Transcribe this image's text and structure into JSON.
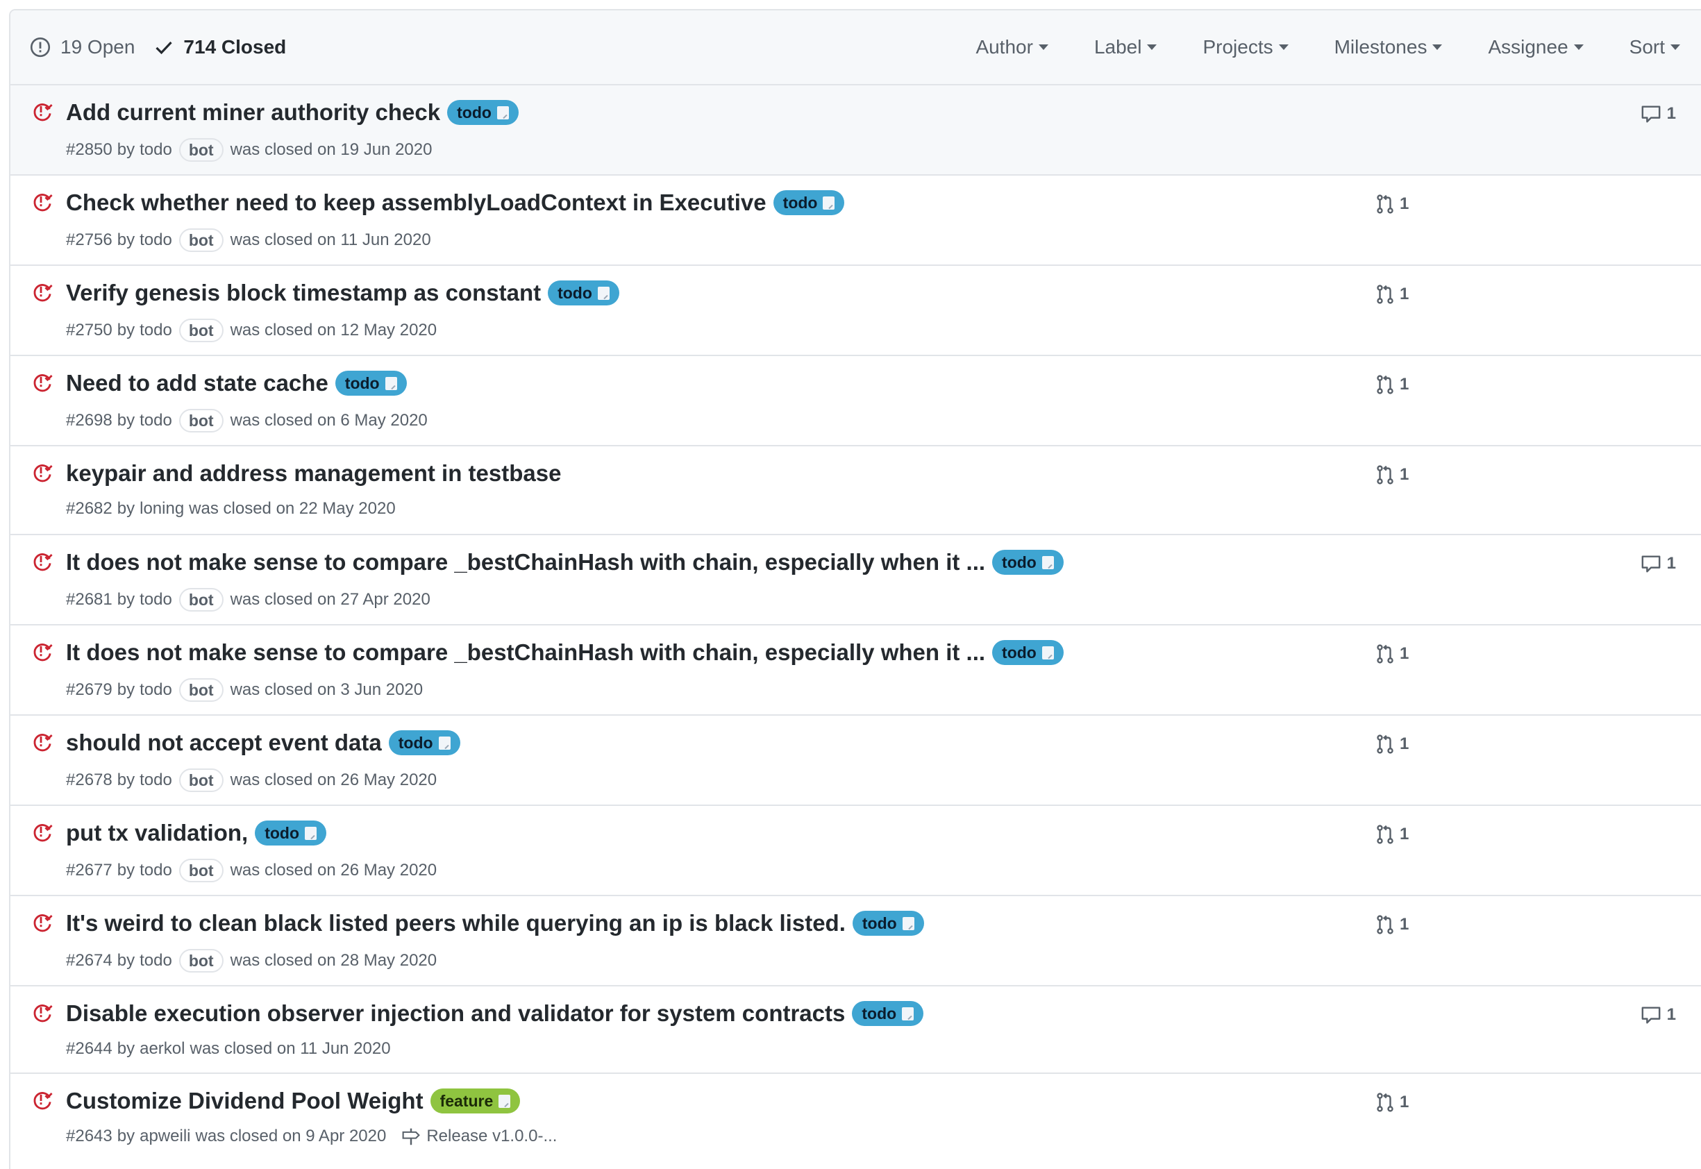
{
  "header": {
    "open_label": "19 Open",
    "closed_label": "714 Closed",
    "filters": [
      "Author",
      "Label",
      "Projects",
      "Milestones",
      "Assignee",
      "Sort"
    ]
  },
  "colors": {
    "closed_icon": "#cb2431",
    "label_todo": "#3fa5d2",
    "label_feature": "#8fc440"
  },
  "issues": [
    {
      "title": "Add current miner authority check",
      "label": "todo",
      "number": "#2850",
      "by": "by",
      "author": "todo",
      "bot": "bot",
      "closed": "was closed on 19 Jun 2020",
      "comments": "1",
      "prs": ""
    },
    {
      "title": "Check whether need to keep assemblyLoadContext in Executive",
      "label": "todo",
      "number": "#2756",
      "by": "by",
      "author": "todo",
      "bot": "bot",
      "closed": "was closed on 11 Jun 2020",
      "comments": "",
      "prs": "1"
    },
    {
      "title": "Verify genesis block timestamp as constant",
      "label": "todo",
      "number": "#2750",
      "by": "by",
      "author": "todo",
      "bot": "bot",
      "closed": "was closed on 12 May 2020",
      "comments": "",
      "prs": "1"
    },
    {
      "title": "Need to add state cache",
      "label": "todo",
      "number": "#2698",
      "by": "by",
      "author": "todo",
      "bot": "bot",
      "closed": "was closed on 6 May 2020",
      "comments": "",
      "prs": "1"
    },
    {
      "title": "keypair and address management in testbase",
      "label": "",
      "number": "#2682",
      "by": "by",
      "author": "loning",
      "bot": "",
      "closed": "was closed on 22 May 2020",
      "comments": "",
      "prs": "1"
    },
    {
      "title": "It does not make sense to compare _bestChainHash with chain, especially when it ...",
      "label": "todo",
      "number": "#2681",
      "by": "by",
      "author": "todo",
      "bot": "bot",
      "closed": "was closed on 27 Apr 2020",
      "comments": "1",
      "prs": ""
    },
    {
      "title": "It does not make sense to compare _bestChainHash with chain, especially when it ...",
      "label": "todo",
      "number": "#2679",
      "by": "by",
      "author": "todo",
      "bot": "bot",
      "closed": "was closed on 3 Jun 2020",
      "comments": "",
      "prs": "1"
    },
    {
      "title": "should not accept event data",
      "label": "todo",
      "number": "#2678",
      "by": "by",
      "author": "todo",
      "bot": "bot",
      "closed": "was closed on 26 May 2020",
      "comments": "",
      "prs": "1"
    },
    {
      "title": "put tx validation,",
      "label": "todo",
      "number": "#2677",
      "by": "by",
      "author": "todo",
      "bot": "bot",
      "closed": "was closed on 26 May 2020",
      "comments": "",
      "prs": "1"
    },
    {
      "title": "It's weird to clean black listed peers while querying an ip is black listed.",
      "label": "todo",
      "number": "#2674",
      "by": "by",
      "author": "todo",
      "bot": "bot",
      "closed": "was closed on 28 May 2020",
      "comments": "",
      "prs": "1"
    },
    {
      "title": "Disable execution observer injection and validator for system contracts",
      "label": "todo",
      "number": "#2644",
      "by": "by",
      "author": "aerkol",
      "bot": "",
      "closed": "was closed on 11 Jun 2020",
      "comments": "1",
      "prs": ""
    },
    {
      "title": "Customize Dividend Pool Weight",
      "label": "feature",
      "number": "#2643",
      "by": "by",
      "author": "apweili",
      "bot": "",
      "closed": "was closed on 9 Apr 2020",
      "comments": "",
      "prs": "1",
      "milestone": "Release v1.0.0-..."
    }
  ]
}
